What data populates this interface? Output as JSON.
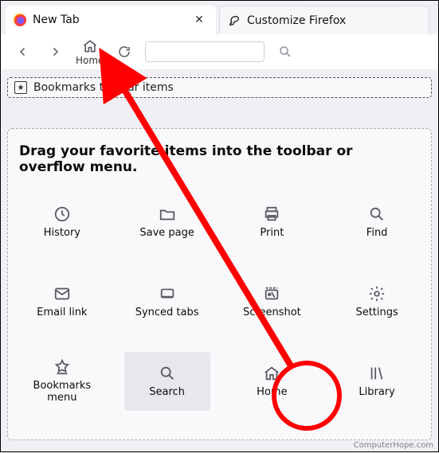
{
  "tabs": [
    {
      "label": "New Tab",
      "active": true
    },
    {
      "label": "Customize Firefox",
      "active": false
    }
  ],
  "nav": {
    "home_label": "Home"
  },
  "bookmarks_toolbar": {
    "label": "Bookmarks toolbar items"
  },
  "dropzone": {
    "title": "Drag your favorite items into the toolbar or overflow menu.",
    "items": [
      {
        "key": "history",
        "label": "History",
        "icon": "clock-icon",
        "highlighted": false
      },
      {
        "key": "save-page",
        "label": "Save page",
        "icon": "folder-icon",
        "highlighted": false
      },
      {
        "key": "print",
        "label": "Print",
        "icon": "printer-icon",
        "highlighted": false
      },
      {
        "key": "find",
        "label": "Find",
        "icon": "magnifier-icon",
        "highlighted": false
      },
      {
        "key": "email-link",
        "label": "Email link",
        "icon": "mail-icon",
        "highlighted": false
      },
      {
        "key": "synced-tabs",
        "label": "Synced tabs",
        "icon": "device-icon",
        "highlighted": false
      },
      {
        "key": "screenshot",
        "label": "Screenshot",
        "icon": "scissors-icon",
        "highlighted": false
      },
      {
        "key": "settings",
        "label": "Settings",
        "icon": "gear-icon",
        "highlighted": false
      },
      {
        "key": "bookmarks-menu",
        "label": "Bookmarks menu",
        "icon": "star-menu-icon",
        "highlighted": false
      },
      {
        "key": "search",
        "label": "Search",
        "icon": "magnifier-icon",
        "highlighted": true
      },
      {
        "key": "home",
        "label": "Home",
        "icon": "home-icon",
        "highlighted": false
      },
      {
        "key": "library",
        "label": "Library",
        "icon": "library-icon",
        "highlighted": false
      }
    ]
  },
  "attribution": "ComputerHope.com"
}
